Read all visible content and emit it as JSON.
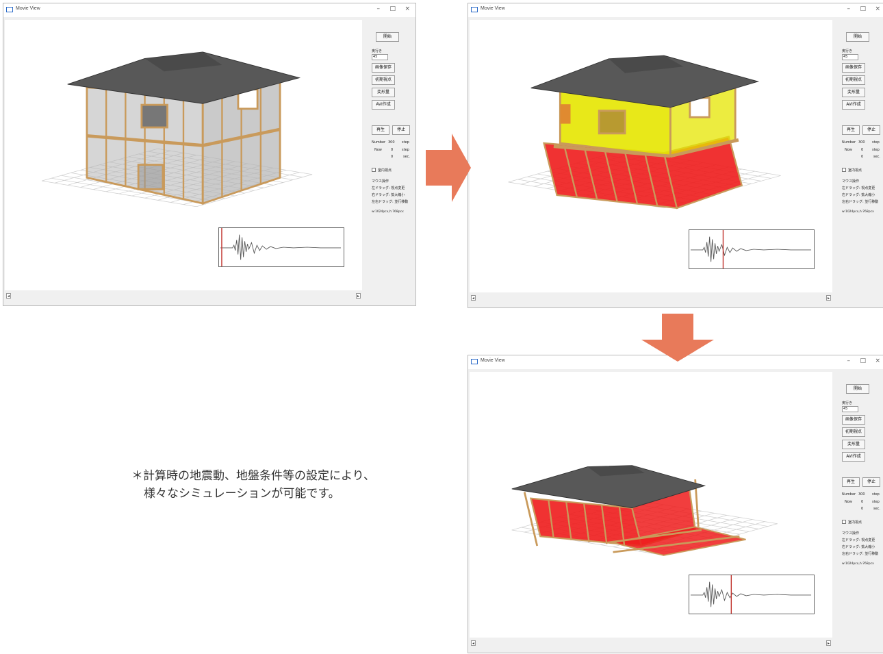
{
  "window": {
    "title": "Movie View",
    "controls": {
      "minimize": "–",
      "maximize": "□",
      "close": "×"
    }
  },
  "panel": {
    "btn_kaishi": "開始",
    "depth_label": "奥行き",
    "depth_value": "45",
    "btn_save_image": "画像保存",
    "btn_initial_view": "初期視点",
    "btn_deformation": "変形量",
    "btn_avi": "AVI作成",
    "btn_play": "再生",
    "btn_stop": "停止",
    "number_label": "Number",
    "number_value": "300",
    "step_unit": "step",
    "now_label": "Now",
    "now_value": "0",
    "time_value": "0",
    "sec_unit": "sec.",
    "indoor_view_label": "室内視点",
    "mouse_title": "マウス操作",
    "mouse_left_drag": "左ドラッグ: 視点変更",
    "mouse_right_drag": "右ドラッグ: 拡大縮小",
    "mouse_both_drag": "左右ドラッグ: 並行移動",
    "size_info": "w:1024pcx,h:768pcx"
  },
  "scroll_arrows": {
    "left": "◂",
    "right": "▸"
  },
  "arrows": {
    "right_color": "#e87a5a",
    "down_color": "#e87a5a"
  },
  "colors": {
    "intact_wall": "#b4b4b4",
    "yield_wall": "#e6e600",
    "damaged_wall": "#ee1c1c",
    "frame": "#c99a5b",
    "roof": "#585858"
  },
  "note": {
    "line1": "＊計算時の地震動、地盤条件等の設定により、",
    "line2": "様々なシミュレーションが可能です。"
  }
}
